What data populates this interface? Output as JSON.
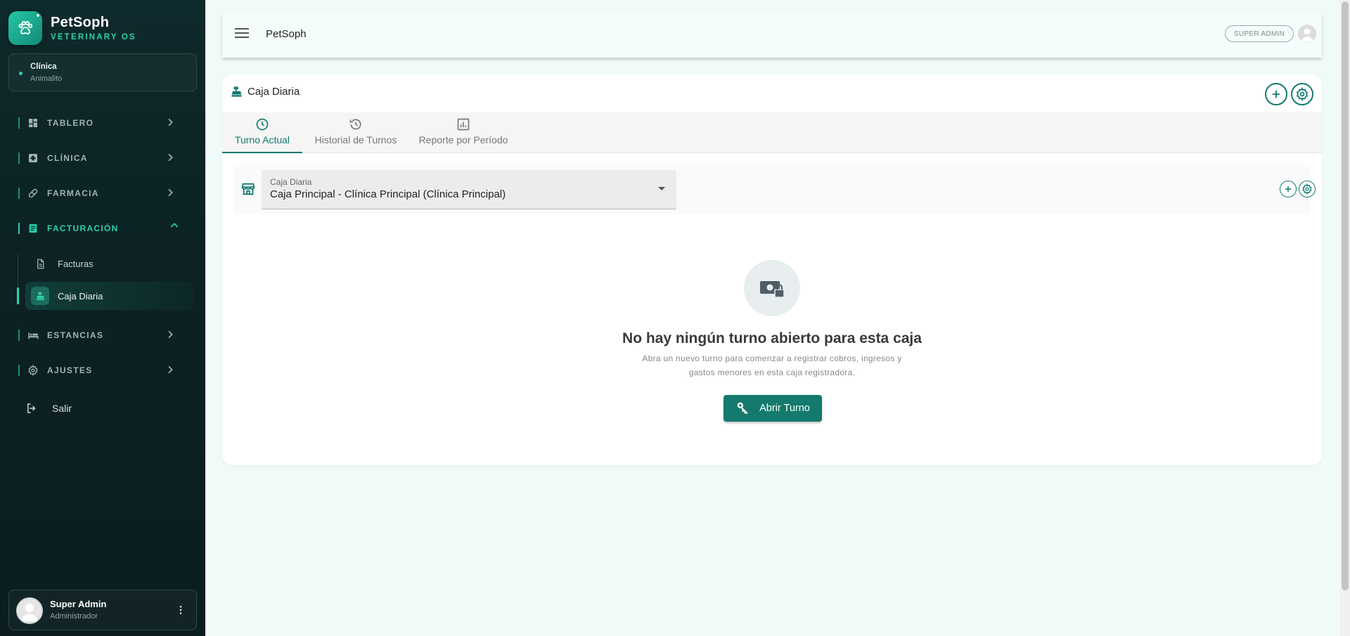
{
  "brand": {
    "name": "PetSoph",
    "subtitle": "VETERINARY OS"
  },
  "clinic": {
    "label": "Clínica",
    "value": "Animalito"
  },
  "nav": {
    "tablero": "TABLERO",
    "clinica": "CLÍNICA",
    "farmacia": "FARMACIA",
    "facturacion": "FACTURACIÓN",
    "facturas": "Facturas",
    "caja_diaria": "Caja Diaria",
    "estancias": "ESTANCIAS",
    "ajustes": "AJUSTES",
    "salir": "Salir"
  },
  "user": {
    "name": "Super Admin",
    "role": "Administrador"
  },
  "topbar": {
    "title": "PetSoph",
    "role_chip": "SUPER ADMIN"
  },
  "card": {
    "title": "Caja Diaria"
  },
  "tabs": [
    {
      "label": "Turno Actual"
    },
    {
      "label": "Historial de Turnos"
    },
    {
      "label": "Reporte por Período"
    }
  ],
  "selector": {
    "label": "Caja Diaria",
    "value": "Caja Principal - Clínica Principal (Clínica Principal)"
  },
  "empty_state": {
    "title": "No hay ningún turno abierto para esta caja",
    "description": "Abra un nuevo turno para comenzar a registrar cobros, ingresos y gastos menores en esta caja registradora.",
    "button_label": "Abrir Turno"
  },
  "colors": {
    "accent": "#137a70",
    "sidebar_accent": "#2bd1ad",
    "sidebar_bg": "#0c2224"
  }
}
